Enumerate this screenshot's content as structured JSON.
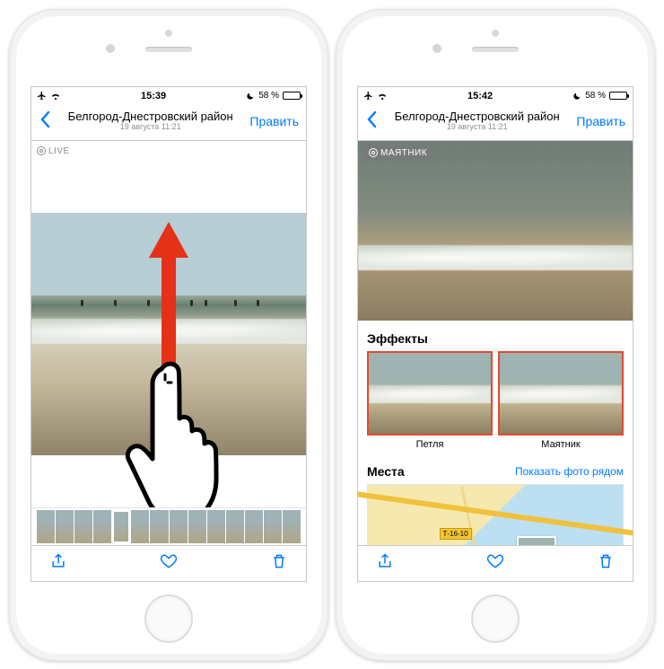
{
  "left": {
    "statusbar": {
      "time": "15:39",
      "battery_pct": "58 %"
    },
    "nav": {
      "title": "Белгород-Днестровский район",
      "subtitle": "19 августа  11:21",
      "edit": "Править"
    },
    "live_badge": "LIVE"
  },
  "right": {
    "statusbar": {
      "time": "15:42",
      "battery_pct": "58 %"
    },
    "nav": {
      "title": "Белгород-Днестровский район",
      "subtitle": "19 августа  11:21",
      "edit": "Править"
    },
    "live_badge": "МАЯТНИК",
    "effects": {
      "heading": "Эффекты",
      "items": [
        {
          "label": "Петля"
        },
        {
          "label": "Маятник"
        }
      ]
    },
    "places": {
      "heading": "Места",
      "link": "Показать фото рядом",
      "road_label": "Т-16-10"
    }
  }
}
